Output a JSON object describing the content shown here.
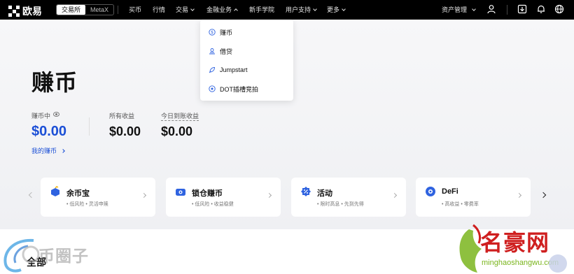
{
  "nav": {
    "logo_text": "欧易",
    "segment": [
      "交易所",
      "MetaX"
    ],
    "items": [
      "买币",
      "行情",
      "交易",
      "金融业务",
      "新手学院",
      "用户支持",
      "更多"
    ],
    "asset_mgmt": "资产管理"
  },
  "dropdown": {
    "items": [
      "赚币",
      "借贷",
      "Jumpstart",
      "DOT插槽竞拍"
    ]
  },
  "hero": {
    "title": "赚币",
    "stats": [
      {
        "label": "赚币中",
        "value": "$0.00"
      },
      {
        "label": "所有收益",
        "value": "$0.00"
      },
      {
        "label": "今日到账收益",
        "value": "$0.00"
      }
    ],
    "my_earn": "我的赚币"
  },
  "cards": [
    {
      "title": "余币宝",
      "tags": "• 低风险   • 灵活申赎",
      "icon": "stack-icon",
      "color": "#2f63e0"
    },
    {
      "title": "锁仓赚币",
      "tags": "• 低风险   • 收益稳健",
      "icon": "lock-coin-icon",
      "color": "#2f63e0"
    },
    {
      "title": "活动",
      "tags": "• 限时高息   • 先到先得",
      "icon": "percent-icon",
      "color": "#2f63e0"
    },
    {
      "title": "DeFi",
      "tags": "• 高收益   • 零费率",
      "icon": "defi-icon",
      "color": "#2f63e0"
    }
  ],
  "bottom": {
    "title": "全部"
  },
  "watermarks": {
    "left": "币圈子",
    "right_title": "名豪网",
    "right_url": "minghaoshangwu.com"
  },
  "colors": {
    "accent": "#1b4fd6",
    "nav_bg": "#000000",
    "watermark_red": "#cf1f1f",
    "watermark_green": "#7ab51d"
  }
}
